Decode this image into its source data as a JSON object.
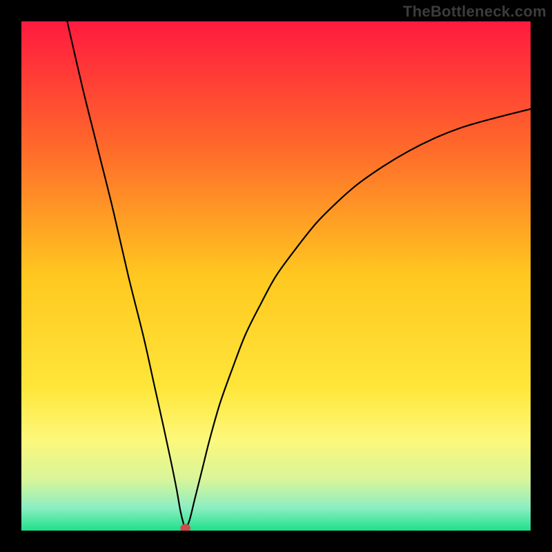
{
  "watermark": "TheBottleneck.com",
  "chart_data": {
    "type": "line",
    "title": "",
    "xlabel": "",
    "ylabel": "",
    "xlim": [
      0,
      100
    ],
    "ylim": [
      0,
      100
    ],
    "grid": false,
    "legend": false,
    "gradient_stops": [
      {
        "offset": 0.0,
        "color": "#ff1a3f"
      },
      {
        "offset": 0.25,
        "color": "#ff6a2a"
      },
      {
        "offset": 0.5,
        "color": "#ffc820"
      },
      {
        "offset": 0.72,
        "color": "#ffe63a"
      },
      {
        "offset": 0.82,
        "color": "#fdf87a"
      },
      {
        "offset": 0.9,
        "color": "#d8f59a"
      },
      {
        "offset": 0.955,
        "color": "#8ceec2"
      },
      {
        "offset": 1.0,
        "color": "#1ee08a"
      }
    ],
    "series": [
      {
        "name": "bottleneck-curve",
        "color": "#000000",
        "x": [
          9.0,
          12.0,
          15.0,
          18.0,
          21.0,
          24.0,
          26.0,
          28.0,
          29.5,
          30.5,
          31.2,
          31.8,
          32.2,
          33.0,
          34.0,
          35.5,
          37.0,
          39.0,
          41.5,
          44.0,
          47.0,
          50.0,
          54.0,
          58.0,
          62.0,
          66.0,
          71.0,
          76.0,
          81.0,
          86.0,
          91.0,
          96.0,
          100.0
        ],
        "y": [
          100.0,
          87.0,
          75.0,
          63.0,
          50.0,
          38.0,
          29.0,
          20.0,
          13.0,
          8.0,
          4.0,
          1.5,
          0.5,
          2.0,
          6.0,
          12.0,
          18.0,
          25.0,
          32.0,
          38.5,
          44.5,
          50.0,
          55.5,
          60.5,
          64.5,
          68.0,
          71.5,
          74.5,
          77.0,
          79.0,
          80.5,
          81.8,
          82.8
        ]
      }
    ],
    "marker": {
      "x": 32.2,
      "y": 0.5,
      "rx": 1.0,
      "ry": 0.8,
      "color": "#d24a4a"
    }
  }
}
